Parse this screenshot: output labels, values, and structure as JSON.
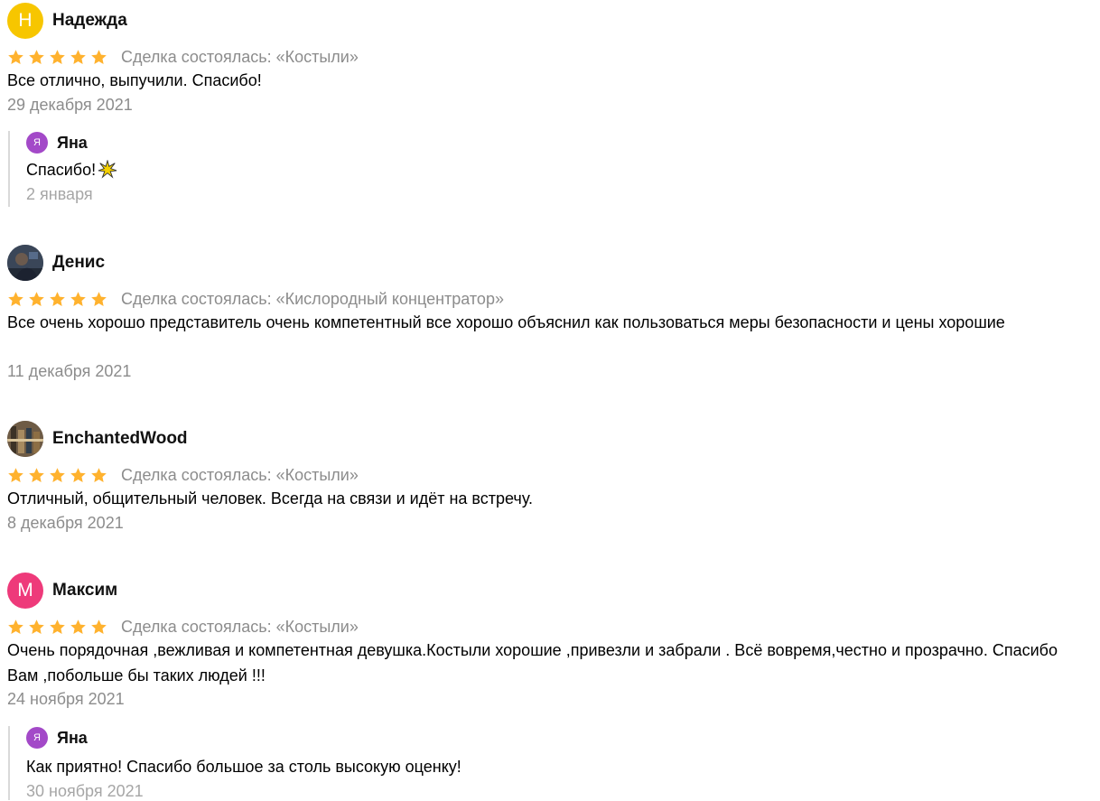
{
  "reviews": [
    {
      "author": "Надежда",
      "avatar_letter": "Н",
      "avatar_color": "#f7c600",
      "stars": 5,
      "deal": "Сделка состоялась: «Костыли»",
      "text": "Все отлично, выпучили. Спасибо!",
      "date": "29 декабря 2021",
      "reply": {
        "author": "Яна",
        "avatar_letter": "Я",
        "avatar_color": "#a349c8",
        "text": "Спасибо!",
        "emoji": "sparkle-emoji",
        "date": "2 января"
      }
    },
    {
      "author": "Денис",
      "avatar_photo": "photo-avatar-icon",
      "stars": 5,
      "deal": "Сделка состоялась: «Кислородный концентратор»",
      "text": "Все очень хорошо представитель очень компетентный все хорошо объяснил как пользоваться меры безопасности и цены хорошие",
      "date": "11 декабря 2021"
    },
    {
      "author": "EnchantedWood",
      "avatar_photo": "photo-avatar-icon",
      "stars": 5,
      "deal": "Сделка состоялась: «Костыли»",
      "text": "Отличный, общительный человек. Всегда на связи и идёт на встречу.",
      "date": "8 декабря 2021"
    },
    {
      "author": "Максим",
      "avatar_letter": "М",
      "avatar_color": "#ee3a7a",
      "stars": 5,
      "deal": "Сделка состоялась: «Костыли»",
      "text": "Очень порядочная ,вежливая и компетентная девушка.Костыли хорошие ,привезли и забрали . Всё вовремя,честно и прозрачно. Спасибо Вам ,побольше бы таких людей !!!",
      "date": "24 ноября 2021",
      "reply": {
        "author": "Яна",
        "avatar_letter": "Я",
        "avatar_color": "#a349c8",
        "text": "Как приятно! Спасибо большое за столь высокую оценку!",
        "date": "30 ноября 2021"
      }
    }
  ],
  "colors": {
    "star": "#ffb22e",
    "muted_text": "#8c8c8c",
    "reply_border": "#d9d9d9"
  }
}
